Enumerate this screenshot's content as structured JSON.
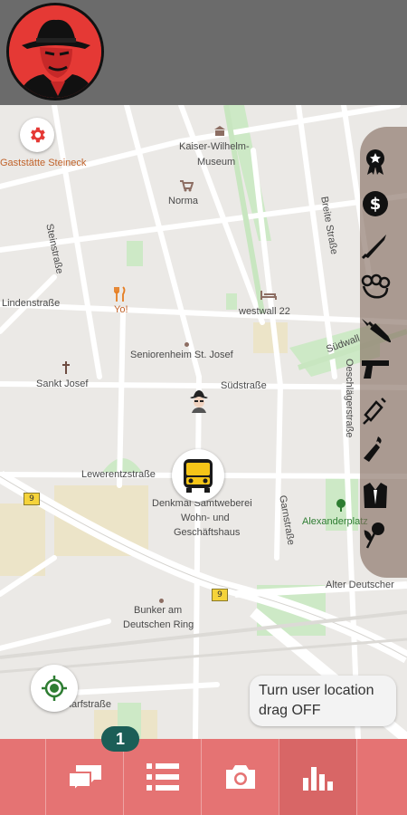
{
  "map": {
    "labels": {
      "gaststaette": "Gaststätte Steineck",
      "kaiser": "Kaiser-Wilhelm-",
      "kaiser2": "Museum",
      "norma": "Norma",
      "steinstrasse": "Steinstraße",
      "breite": "Breite Straße",
      "lindenstrasse": "Lindenstraße",
      "yo": "Yo!",
      "westwall": "westwall 22",
      "suedwall": "Südwall",
      "seniorenheim": "Seniorenheim St. Josef",
      "sanktjosef": "Sankt Josef",
      "suedstrasse": "Südstraße",
      "oeschlaeger": "Oeschlägerstraße",
      "lewerentz": "Lewerentzstraße",
      "denkmal1": "Denkmal Samtweberei",
      "denkmal2": "Wohn- und",
      "denkmal3": "Geschäftshaus",
      "garnstrasse": "Garnstraße",
      "alexanderplatz": "Alexanderplatz",
      "alterdeutscher": "Alter Deutscher",
      "bunker1": "Bunker am",
      "bunker2": "Deutschen Ring",
      "scharf": "Scharfstraße",
      "road9a": "9",
      "road9b": "9"
    }
  },
  "toast": {
    "line1": "Turn user location",
    "line2": "drag OFF"
  },
  "badge": {
    "count": "1"
  },
  "icons": {
    "settings": "gear-icon",
    "locate": "crosshair-icon",
    "side": [
      "badge-icon",
      "dollar-icon",
      "knife-icon",
      "brass-knuckles-icon",
      "dagger-icon",
      "pistol-icon",
      "syringe-icon",
      "molotov-icon",
      "suit-icon",
      "rose-icon"
    ],
    "tabs": [
      "chat-icon",
      "list-icon",
      "camera-icon",
      "bar-chart-icon"
    ]
  },
  "colors": {
    "header": "#6b6b6b",
    "avatar": "#e53935",
    "bottom_bar": "#e57373",
    "badge": "#1b5e57",
    "side_panel": "#877064",
    "settings_icon": "#e53935",
    "locate_icon": "#2e7d32"
  }
}
